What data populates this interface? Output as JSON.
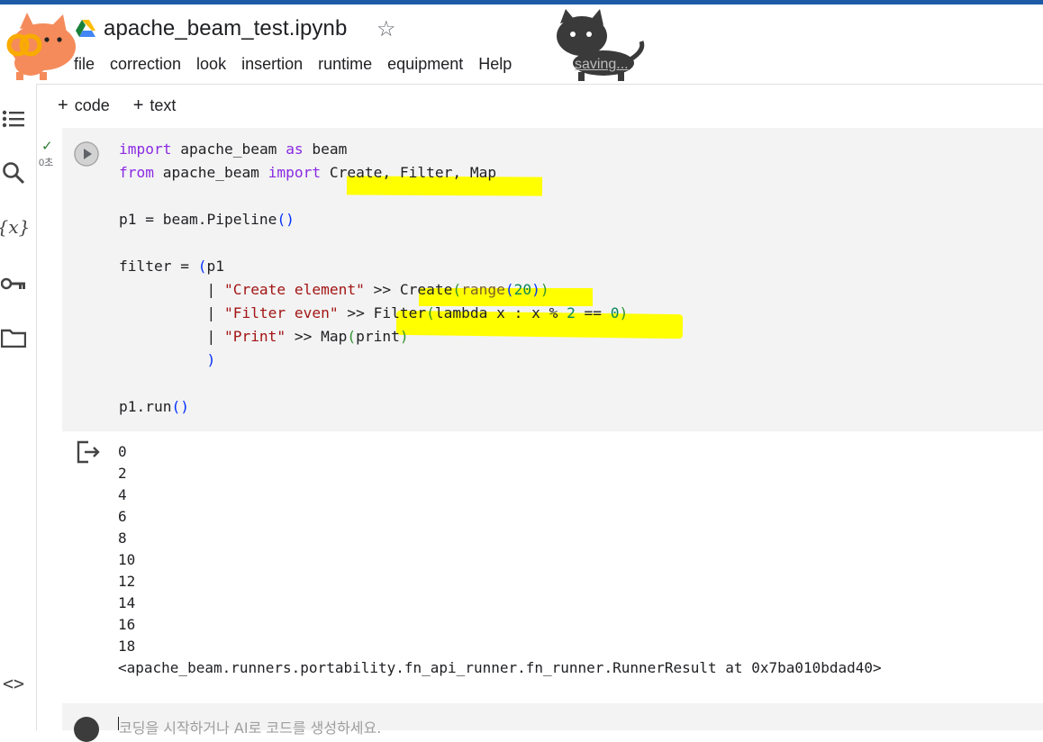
{
  "header": {
    "title": "apache_beam_test.ipynb",
    "star_icon": "☆",
    "saving": "saving...",
    "menu": [
      "file",
      "correction",
      "look",
      "insertion",
      "runtime",
      "equipment",
      "Help"
    ]
  },
  "toolbar": {
    "code_label": "code",
    "text_label": "text",
    "plus": "+"
  },
  "cell": {
    "status_mark": "✓",
    "exec_time": "0초",
    "code_lines": [
      "import apache_beam as beam",
      "from apache_beam import Create, Filter, Map",
      "",
      "p1 = beam.Pipeline()",
      "",
      "filter = (p1",
      "          | \"Create element\" >> Create(range(20))",
      "          | \"Filter even\" >> Filter(lambda x : x % 2 == 0)",
      "          | \"Print\" >> Map(print)",
      "          )",
      "",
      "p1.run()"
    ]
  },
  "output": {
    "lines": [
      "0",
      "2",
      "4",
      "6",
      "8",
      "10",
      "12",
      "14",
      "16",
      "18",
      "<apache_beam.runners.portability.fn_api_runner.fn_runner.RunnerResult at 0x7ba010bdad40>"
    ]
  },
  "next_cell": {
    "placeholder": "코딩을 시작하거나 AI로 코드를 생성하세요."
  },
  "colors": {
    "highlight": "#ffff00",
    "accent_bar": "#1c5aa6"
  },
  "icons": [
    "toc-icon",
    "search-icon",
    "variables-icon",
    "key-icon",
    "folder-icon",
    "code-snippets-icon",
    "run-icon",
    "output-icon",
    "drive-icon",
    "star-icon"
  ]
}
